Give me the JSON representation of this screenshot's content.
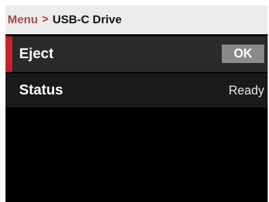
{
  "header": {
    "breadcrumb_parent": "Menu",
    "breadcrumb_separator": ">",
    "breadcrumb_current": "USB-C Drive"
  },
  "rows": [
    {
      "label": "Eject",
      "action_label": "OK",
      "selected": true
    },
    {
      "label": "Status",
      "value": "Ready",
      "selected": false
    }
  ],
  "colors": {
    "accent": "#c8202e",
    "header_background": "#ececec",
    "screen_background": "#000000",
    "selected_row": "#2a2a2a",
    "row": "#1a1a1a",
    "button": "#8a8a8a"
  }
}
